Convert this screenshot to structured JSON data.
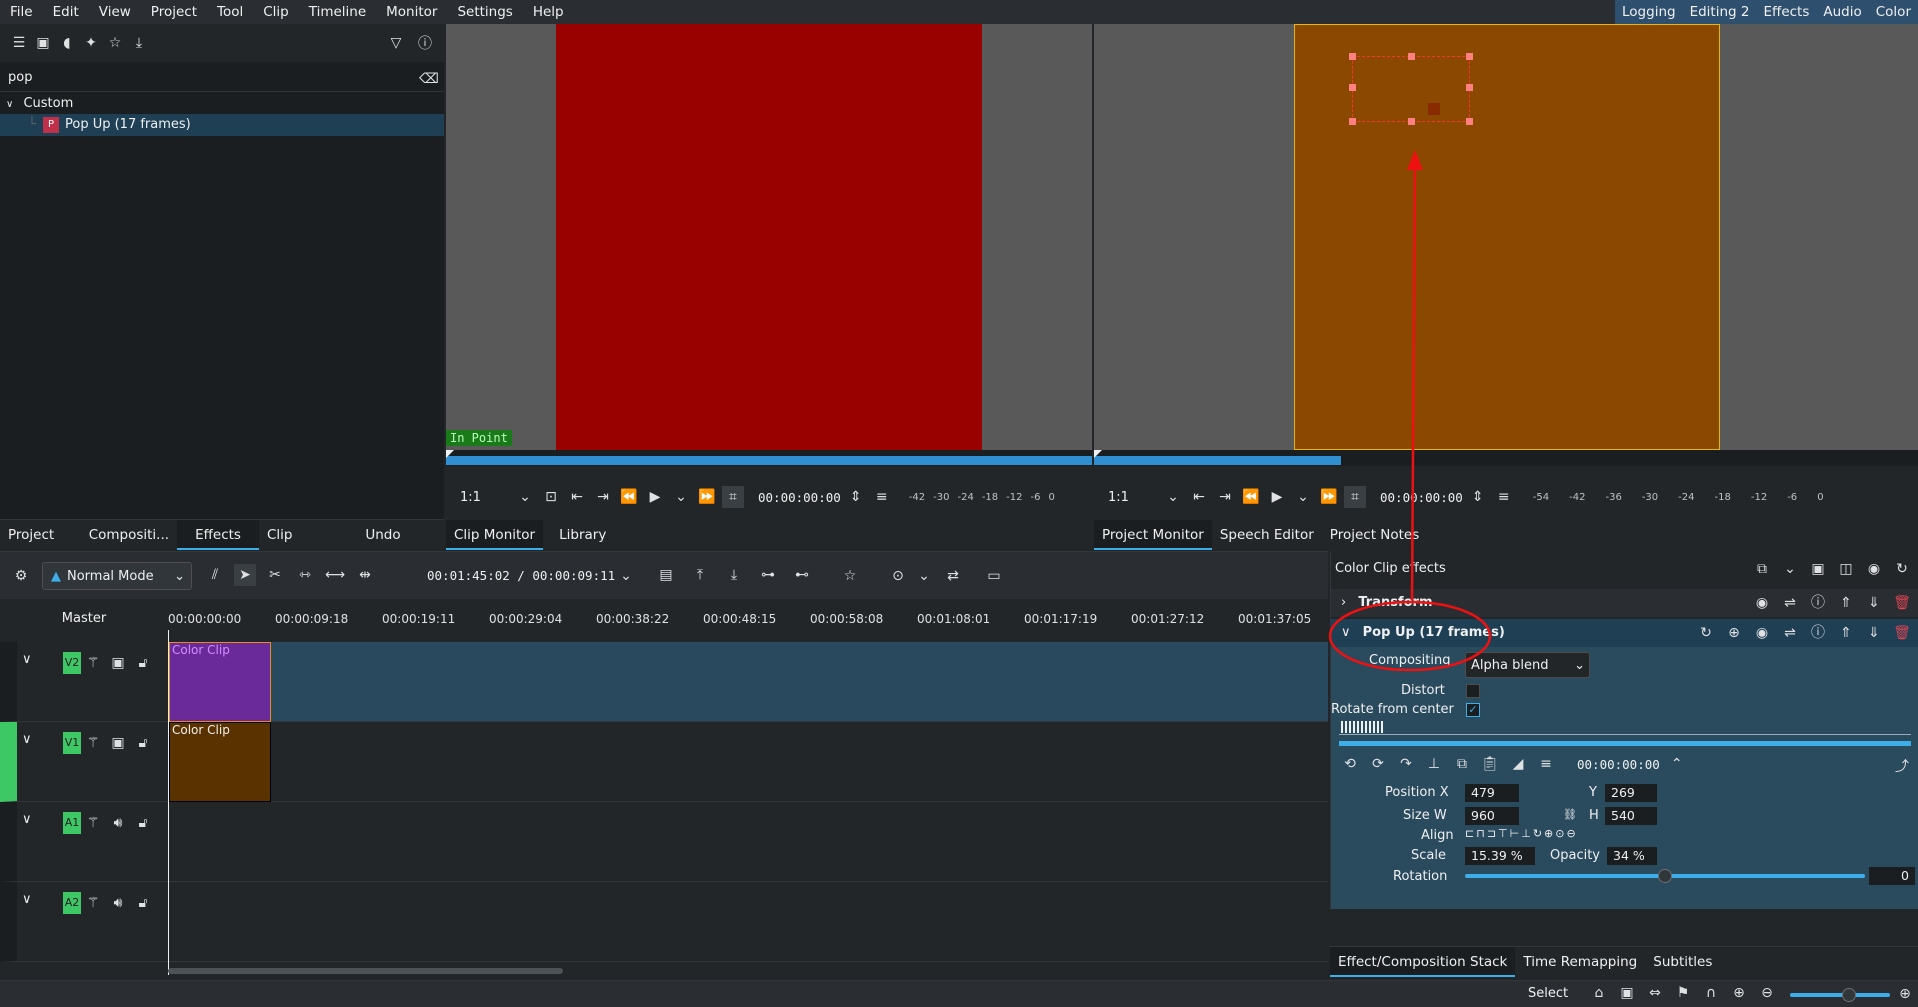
{
  "menubar": {
    "items": [
      "File",
      "Edit",
      "View",
      "Project",
      "Tool",
      "Clip",
      "Timeline",
      "Monitor",
      "Settings",
      "Help"
    ],
    "layouts": [
      "Logging",
      "Editing 2",
      "Effects",
      "Audio",
      "Color"
    ]
  },
  "effects_panel": {
    "search_value": "pop",
    "tree": {
      "category": "Custom",
      "item": "Pop Up (17 frames)",
      "item_badge": "P"
    },
    "tabs": [
      "Project Bin",
      "Compositi...",
      "Effects",
      "Clip Propert...",
      "Undo Hist..."
    ],
    "active_tab": "Effects"
  },
  "clip_monitor": {
    "zoom": "1:1",
    "timecode": "00:00:00:00",
    "in_point_label": "In Point",
    "vu_labels": [
      "-42",
      "-30",
      "-24",
      "-18",
      "-12",
      "-6",
      "0"
    ],
    "tabs": [
      "Clip Monitor",
      "Library"
    ],
    "frame_color": "#990000",
    "progress": 1.0
  },
  "project_monitor": {
    "zoom": "1:1",
    "timecode": "00:00:00:00",
    "vu_labels": [
      "-54",
      "-42",
      "-36",
      "-30",
      "-24",
      "-18",
      "-12",
      "-6",
      "0"
    ],
    "tabs": [
      "Project Monitor",
      "Speech Editor",
      "Project Notes"
    ],
    "frame_color": "#8a4800",
    "progress": 0.3
  },
  "timeline_toolbar": {
    "mode": "Normal Mode",
    "timecode": "00:01:45:02 / 00:00:09:11"
  },
  "timeline": {
    "master_label": "Master",
    "ruler": [
      "00:00:00:00",
      "00:00:09:18",
      "00:00:19:11",
      "00:00:29:04",
      "00:00:38:22",
      "00:00:48:15",
      "00:00:58:08",
      "00:01:08:01",
      "00:01:17:19",
      "00:01:27:12",
      "00:01:37:05"
    ],
    "tracks": [
      {
        "tag": "V2",
        "type": "video",
        "clip": "Color Clip",
        "clip_color": "#6a2a9a"
      },
      {
        "tag": "V1",
        "type": "video",
        "clip": "Color Clip",
        "clip_color": "#5a3200"
      },
      {
        "tag": "A1",
        "type": "audio",
        "clip": ""
      },
      {
        "tag": "A2",
        "type": "audio",
        "clip": ""
      }
    ]
  },
  "fx_panel": {
    "title": "Color Clip effects",
    "effects": [
      {
        "name": "Transform"
      },
      {
        "name": "Pop Up (17 frames)"
      }
    ],
    "compositing_label": "Compositing",
    "compositing_value": "Alpha blend",
    "distort_label": "Distort",
    "distort_checked": false,
    "rotate_label": "Rotate from center",
    "rotate_checked": true,
    "keyframe_timecode": "00:00:00:00",
    "position_label": "Position X",
    "position_x": "479",
    "y_label": "Y",
    "position_y": "269",
    "size_label": "Size W",
    "size_w": "960",
    "h_label": "H",
    "size_h": "540",
    "align_label": "Align",
    "scale_label": "Scale",
    "scale_value": "15.39 %",
    "opacity_label": "Opacity",
    "opacity_value": "34 %",
    "rotation_label": "Rotation",
    "rotation_value": "0",
    "tabs": [
      "Effect/Composition Stack",
      "Time Remapping",
      "Subtitles"
    ]
  },
  "statusbar": {
    "tool": "Select"
  }
}
